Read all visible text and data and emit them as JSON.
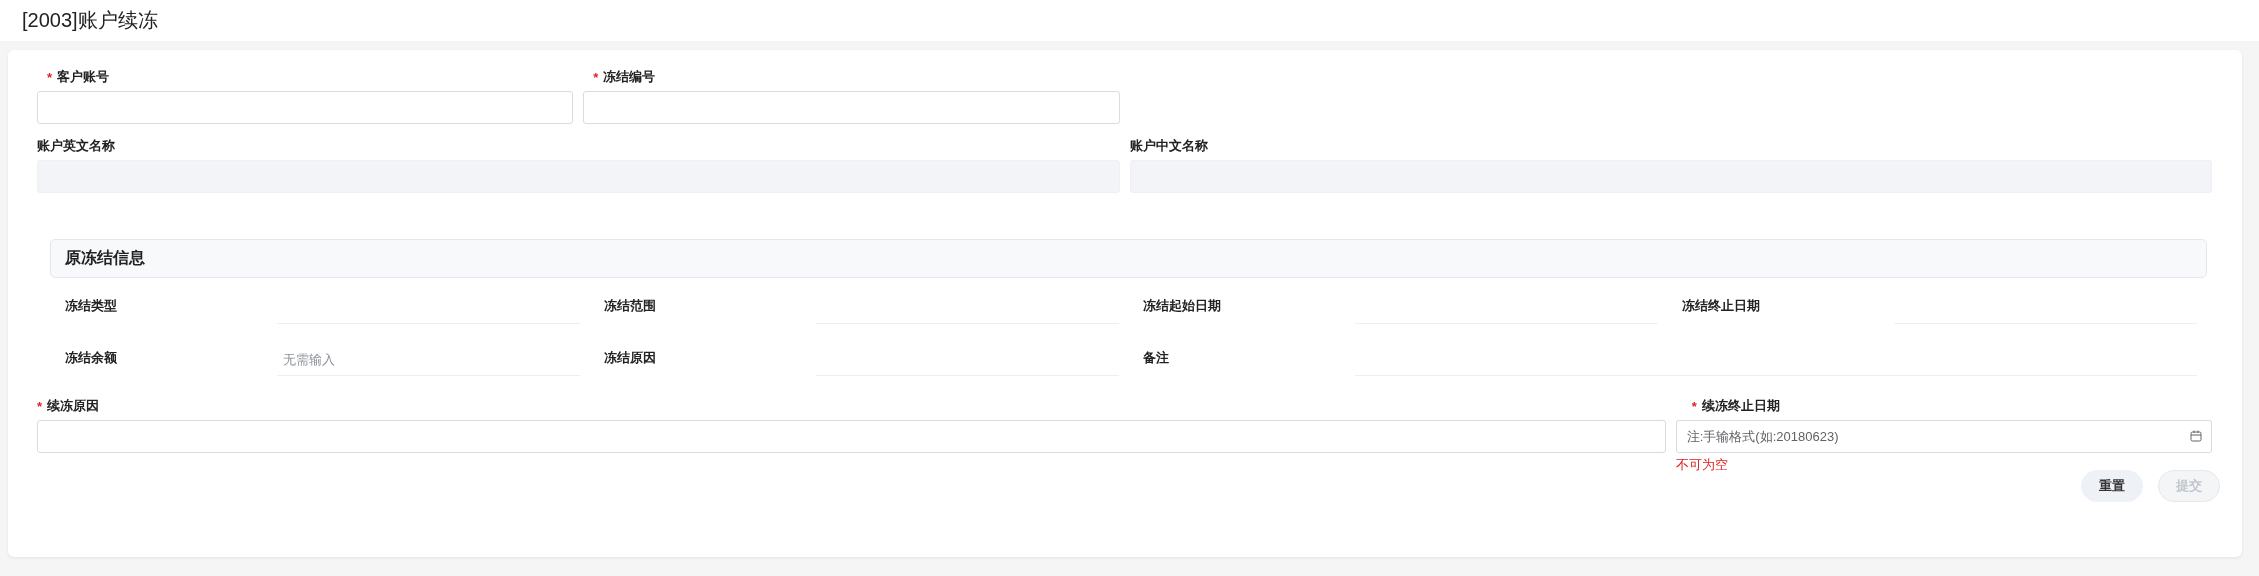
{
  "title": "[2003]账户续冻",
  "fields": [
    {
      "label": "客户账号",
      "required_mark": "*",
      "disabled": false
    },
    {
      "label": "冻结编号",
      "required_mark": "*",
      "disabled": false
    },
    {
      "label": "账户英文名称",
      "disabled": true
    },
    {
      "label": "账户中文名称",
      "disabled": true
    }
  ],
  "original_freeze": {
    "title": "原冻结信息",
    "items": [
      {
        "label": "冻结类型"
      },
      {
        "label": "冻结范围"
      },
      {
        "label": "冻结起始日期"
      },
      {
        "label": "冻结终止日期"
      },
      {
        "label": "冻结余额",
        "placeholder": "无需输入"
      },
      {
        "label": "冻结原因"
      },
      {
        "label": "备注"
      }
    ]
  },
  "renewal_reason": {
    "label": "续冻原因",
    "required_mark": "*"
  },
  "renewal_end_date": {
    "label": "续冻终止日期",
    "required_mark": "*",
    "placeholder": "注:手输格式(如:20180623)",
    "error": "不可为空"
  },
  "buttons": [
    {
      "label": "重置",
      "disabled": false
    },
    {
      "label": "提交",
      "disabled": true
    }
  ]
}
